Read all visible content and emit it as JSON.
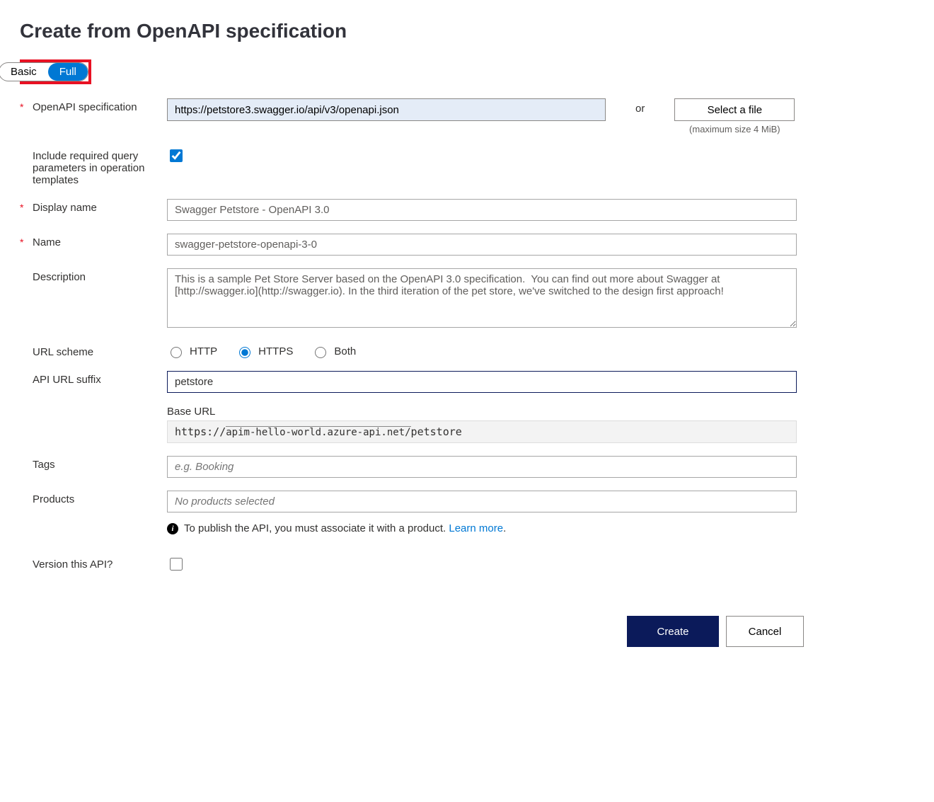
{
  "title": "Create from OpenAPI specification",
  "toggle": {
    "basic": "Basic",
    "full": "Full"
  },
  "labels": {
    "openapi_spec": "OpenAPI specification",
    "include_required": "Include required query parameters in operation templates",
    "display_name": "Display name",
    "name": "Name",
    "description": "Description",
    "url_scheme": "URL scheme",
    "api_url_suffix": "API URL suffix",
    "base_url": "Base URL",
    "tags": "Tags",
    "products": "Products",
    "version_api": "Version this API?"
  },
  "fields": {
    "openapi_spec_value": "https://petstore3.swagger.io/api/v3/openapi.json",
    "or": "or",
    "select_file": "Select a file",
    "max_size": "(maximum size 4 MiB)",
    "include_required_checked": true,
    "display_name_value": "Swagger Petstore - OpenAPI 3.0",
    "name_value": "swagger-petstore-openapi-3-0",
    "description_value": "This is a sample Pet Store Server based on the OpenAPI 3.0 specification.  You can find out more about Swagger at [http://swagger.io](http://swagger.io). In the third iteration of the pet store, we've switched to the design first approach!",
    "url_scheme_options": {
      "http": "HTTP",
      "https": "HTTPS",
      "both": "Both"
    },
    "url_scheme_selected": "https",
    "api_url_suffix_value": "petstore",
    "base_url_prefix": "https://",
    "base_url_host": "apim-hello-world.azure-api.net/",
    "base_url_suffix": "petstore",
    "tags_placeholder": "e.g. Booking",
    "products_placeholder": "No products selected",
    "publish_hint": "To publish the API, you must associate it with a product. ",
    "learn_more": "Learn more",
    "version_api_checked": false
  },
  "footer": {
    "create": "Create",
    "cancel": "Cancel"
  }
}
